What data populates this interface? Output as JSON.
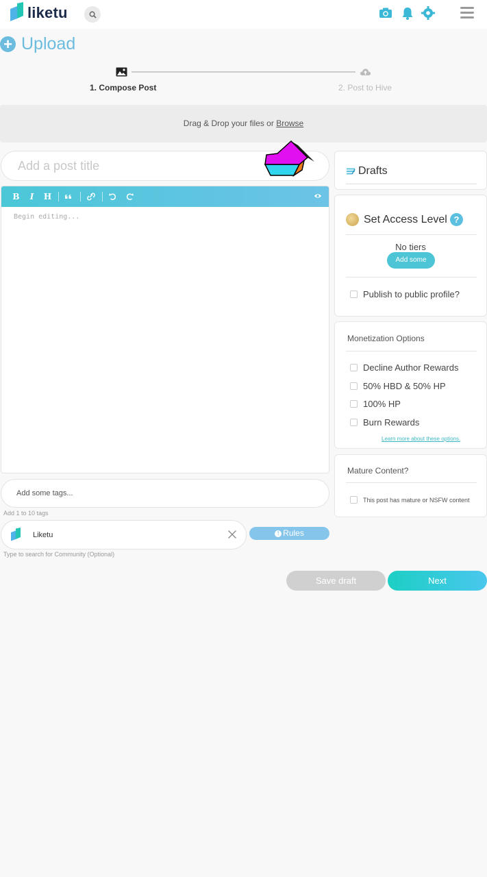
{
  "header": {
    "brand": "liketu",
    "icons": [
      "liketu-logo-icon",
      "search-icon",
      "camera-icon",
      "bell-icon",
      "settings-icon",
      "menu-icon"
    ]
  },
  "page": {
    "title": "Upload"
  },
  "stepper": {
    "step1_label": "1. Compose Post",
    "step2_label": "2. Post to Hive"
  },
  "dropzone": {
    "text": "Drag & Drop your files or ",
    "browse": "Browse"
  },
  "post": {
    "title_placeholder": "Add a post title",
    "editor_placeholder": "Begin editing...",
    "toolbar": [
      "B",
      "I",
      "H"
    ],
    "tags_placeholder": "Add some tags...",
    "tags_help": "Add 1 to 10 tags",
    "community_name": "Liketu",
    "rules_label": "Rules",
    "community_help": "Type to search for Community (Optional)"
  },
  "sidebar": {
    "drafts_title": "Drafts",
    "access_title": "Set Access Level",
    "access_help": "?",
    "no_tiers": "No tiers",
    "add_some": "Add some",
    "publish_public": "Publish to public profile?",
    "monetization_title": "Monetization Options",
    "monetization_options": [
      "Decline Author Rewards",
      "50% HBD & 50% HP",
      "100% HP",
      "Burn Rewards"
    ],
    "learn_more": "Learn more about these options.",
    "mature_title": "Mature Content?",
    "mature_label": "This post has mature or NSFW content"
  },
  "actions": {
    "save_draft": "Save draft",
    "next": "Next"
  },
  "colors": {
    "accent": "#4ec5d6",
    "upload_blue": "#6cbce0",
    "rules_blue": "#85c5ec"
  }
}
